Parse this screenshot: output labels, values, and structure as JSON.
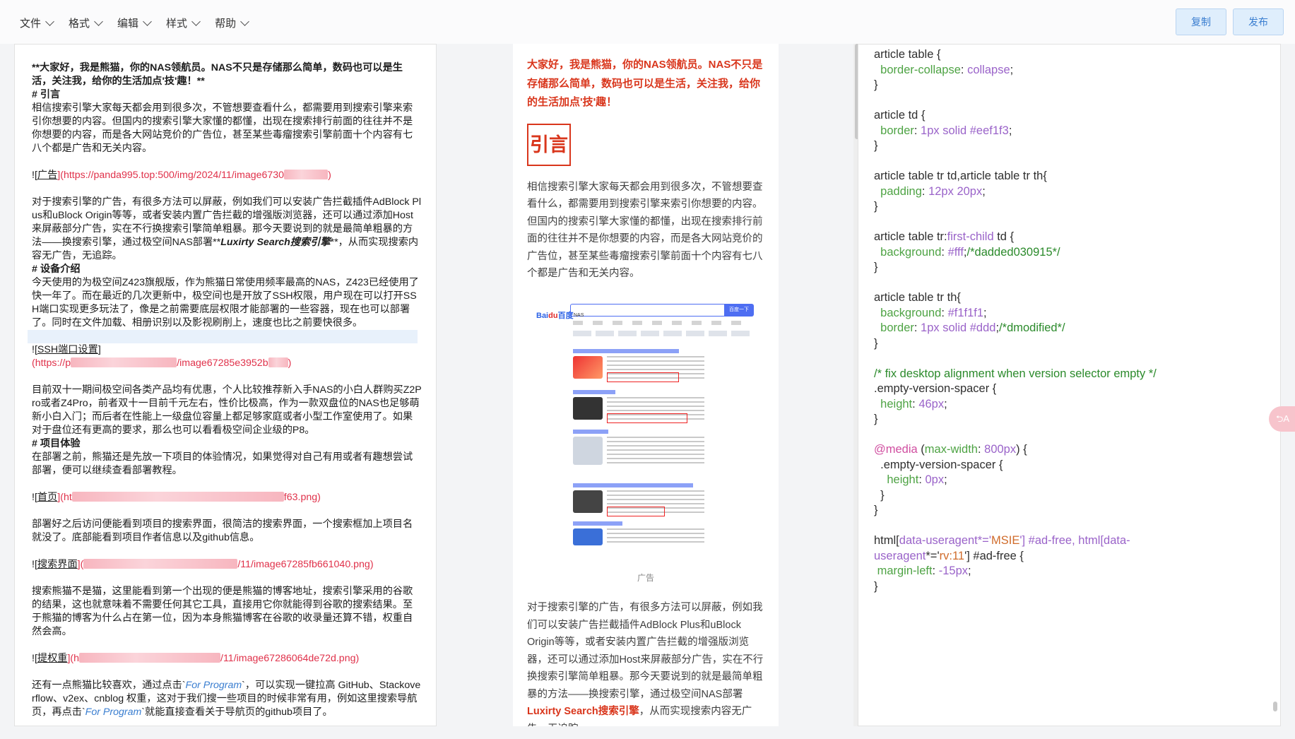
{
  "menu": [
    {
      "label": "文件"
    },
    {
      "label": "格式"
    },
    {
      "label": "编辑"
    },
    {
      "label": "样式"
    },
    {
      "label": "帮助"
    }
  ],
  "toolbar": {
    "copy_label": "复制",
    "publish_label": "发布"
  },
  "editor": {
    "l1": "**大家好，我是熊猫，你的NAS领航员。NAS不只是存储那么简单，数码也可以是生活，关注我，给你的生活加点'技'趣！**",
    "l2": "# 引言",
    "l3": "相信搜索引擎大家每天都会用到很多次，不管想要查看什么，都需要用到搜索引擎来索引你想要的内容。但国内的搜索引擎大家懂的都懂，出现在搜索排行前面的往往并不是你想要的内容，而是各大网站竞价的广告位，甚至某些毒瘤搜索引擎前面十个内容有七八个都是广告和无关内容。",
    "l4a": "![",
    "l4b": "广告",
    "l4c": "](https://panda995.top:500/img/2024/11/image6730",
    "l4d": ")",
    "l5a": "对于搜索引擎的广告，有很多方法可以屏蔽，例如我们可以安装广告拦截插件AdBlock Plus和uBlock Origin等等，或者安装内置广告拦截的增强版浏览器，还可以通过添加Host来屏蔽部分广告，实在不行换搜索引擎简单粗暴。那今天要说到的就是最简单粗暴的方法——换搜索引擎，通过极空间NAS部署**",
    "l5b": "Luxirty Search搜索引擎",
    "l5c": "**，从而实现搜索内容无广告，无追踪。",
    "l6": "# 设备介绍",
    "l7": "今天使用的为极空间Z423旗舰版，作为熊猫日常使用频率最高的NAS，Z423已经使用了快一年了。而在最近的几次更新中，极空间也是开放了SSH权限，用户现在可以打开SSH端口实现更多玩法了，像是之前需要底层权限才能部署的一些容器，现在也可以部署了。同时在文件加载、相册识别以及影视刷削上，速度也比之前要快很多。",
    "l8a": "![",
    "l8b": "SSH端口设置",
    "l8c": "]",
    "l8d": "(https://p",
    "l8e": "/image67285e3952b",
    "l8f": ")",
    "l9": "目前双十一期间极空间各类产品均有优惠，个人比较推荐新入手NAS的小白人群购买Z2Pro或者Z4Pro，前者双十一目前千元左右，性价比极高，作为一款双盘位的NAS也足够萌新小白入门；而后者在性能上一级盘位容量上都足够家庭或者小型工作室使用了。如果对于盘位还有更高的要求，那么也可以看看极空间企业级的P8。",
    "l10": "# 项目体验",
    "l11": "在部署之前，熊猫还是先放一下项目的体验情况，如果觉得对自己有用或者有趣想尝试部署，便可以继续查看部署教程。",
    "l12a": "![",
    "l12b": "首页",
    "l12c": "](ht",
    "l12d": "f63.png)",
    "l13": "部署好之后访问便能看到项目的搜索界面，很简洁的搜索界面，一个搜索框加上项目名就没了。底部能看到项目作者信息以及github信息。",
    "l14a": "![",
    "l14b": "搜索界面",
    "l14c": "](",
    "l14d": "/11/image67285fb661040.png)",
    "l15": "搜索熊猫不是猫，这里能看到第一个出现的便是熊猫的博客地址，搜索引擎采用的谷歌的结果，这也就意味着不需要任何其它工具，直接用它你就能得到谷歌的搜索结果。至于熊猫的博客为什么占在第一位，因为本身熊猫博客在谷歌的收录量还算不错，权重自然会高。",
    "l16a": "![",
    "l16b": "提权重",
    "l16c": "](h",
    "l16d": "/11/image67286064de72d.png)",
    "l17a": "还有一点熊猫比较喜欢，通过点击`",
    "l17b": "For Program",
    "l17c": "`，可以实现一键拉高 GitHub、Stackoverflow、v2ex、cnblog 权重，这对于我们搜一些项目的时候非常有用，例如这里搜索导航页，再点击`",
    "l17d": "For Program",
    "l17e": "`就能直接查看关于导航页的github项目了。"
  },
  "preview": {
    "lead": "大家好，我是熊猫，你的NAS领航员。NAS不只是存储那么简单，数码也可以是生活，关注我，给你的生活加点'技'趣！",
    "h1": "引言",
    "p1": "相信搜索引擎大家每天都会用到很多次，不管想要查看什么，都需要用到搜索引擎来索引你想要的内容。但国内的搜索引擎大家懂的都懂，出现在搜索排行前面的往往并不是你想要的内容，而是各大网站竞价的广告位，甚至某些毒瘤搜索引擎前面十个内容有七八个都是广告和无关内容。",
    "img_caption": "广告",
    "shot_query": "NAS",
    "shot_button": "百度一下",
    "p2a": "对于搜索引擎的广告，有很多方法可以屏蔽，例如我们可以安装广告拦截插件AdBlock Plus和uBlock Origin等等，或者安装内置广告拦截的增强版浏览器，还可以通过添加Host来屏蔽部分广告，实在不行换搜索引擎简单粗暴。那今天要说到的就是最简单粗暴的方法——换搜索引擎，通过极空间NAS部署",
    "p2b": "Luxirty Search搜索引擎",
    "p2c": "，从而实现搜索内容无广告，无追踪。"
  },
  "css_editor": {
    "lines": [
      "article table {",
      "  border-collapse: collapse;",
      "}",
      "",
      "article td {",
      "  border: 1px solid #eef1f3;",
      "}",
      "",
      "article table tr td,article table tr th{",
      "  padding:12px 20px;",
      "}",
      "",
      "article table tr:first-child td {",
      "  background:#fff;/*dadded030915*/",
      "}",
      "",
      "article table tr th{",
      "  background:#f1f1f1;",
      "  border: 1px solid #ddd;/*dmodified*/",
      "}",
      "",
      "/* fix desktop alignment when version selector empty */",
      ".empty-version-spacer {",
      "  height:46px;",
      "}",
      "",
      "@media (max-width: 800px) {",
      "  .empty-version-spacer {",
      "    height:0px;",
      "  }",
      "}",
      "",
      "html[data-useragent*='MSIE'] #ad-free, html[data-",
      "useragent*='rv:11'] #ad-free {",
      " margin-left: -15px;",
      "}"
    ]
  },
  "float_tag": "⮌A",
  "colors": {
    "accent": "#3a7ed0",
    "heading_red": "#d9361c",
    "link_red": "#e0314a",
    "prop_green": "#4ea344",
    "value_purple": "#9a63c9"
  }
}
